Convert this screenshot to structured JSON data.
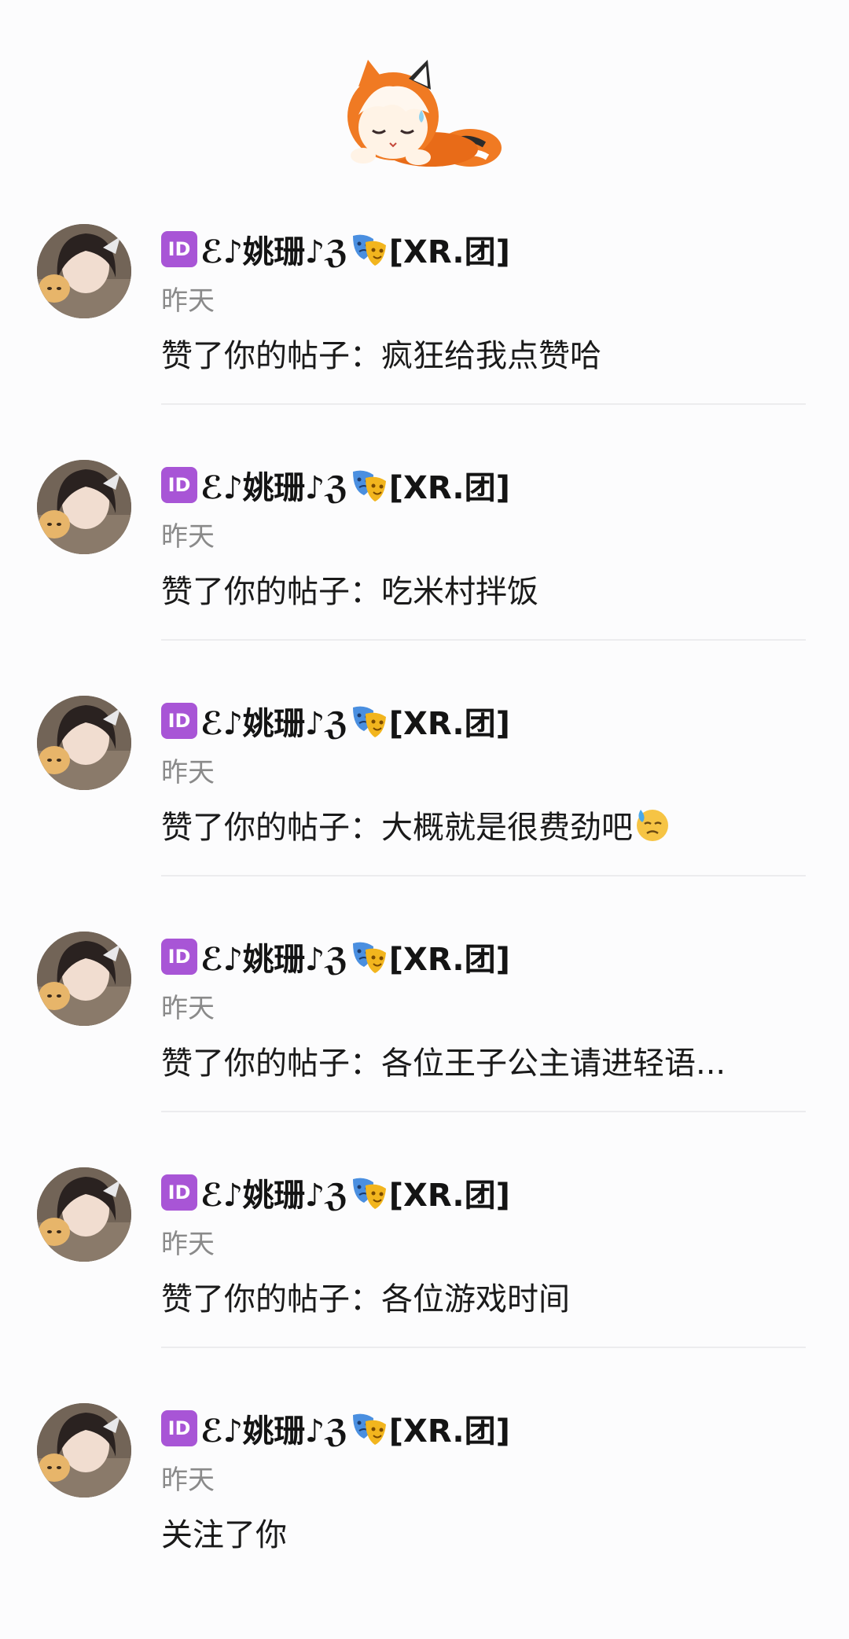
{
  "header": {
    "mascot_icon": "sleeping-mascot-icon"
  },
  "notifications": [
    {
      "badge": "ID",
      "name": "ℰ♪姚珊♪ℨ",
      "name_tag": "[XR.团]",
      "time": "昨天",
      "action": "赞了你的帖子：疯狂给我点赞哈",
      "emoji": ""
    },
    {
      "badge": "ID",
      "name": "ℰ♪姚珊♪ℨ",
      "name_tag": "[XR.团]",
      "time": "昨天",
      "action": "赞了你的帖子：吃米村拌饭",
      "emoji": ""
    },
    {
      "badge": "ID",
      "name": "ℰ♪姚珊♪ℨ",
      "name_tag": "[XR.团]",
      "time": "昨天",
      "action": "赞了你的帖子：大概就是很费劲吧",
      "emoji": "sweat-face-icon"
    },
    {
      "badge": "ID",
      "name": "ℰ♪姚珊♪ℨ",
      "name_tag": "[XR.团]",
      "time": "昨天",
      "action": "赞了你的帖子：各位王子公主请进轻语...",
      "emoji": ""
    },
    {
      "badge": "ID",
      "name": "ℰ♪姚珊♪ℨ",
      "name_tag": "[XR.团]",
      "time": "昨天",
      "action": "赞了你的帖子：各位游戏时间",
      "emoji": ""
    },
    {
      "badge": "ID",
      "name": "ℰ♪姚珊♪ℨ",
      "name_tag": "[XR.团]",
      "time": "昨天",
      "action": "关注了你",
      "emoji": ""
    }
  ],
  "colors": {
    "badge": "#a855d6",
    "time": "#8a8a8a",
    "divider": "#ececee",
    "mascot_orange": "#f07a23"
  }
}
